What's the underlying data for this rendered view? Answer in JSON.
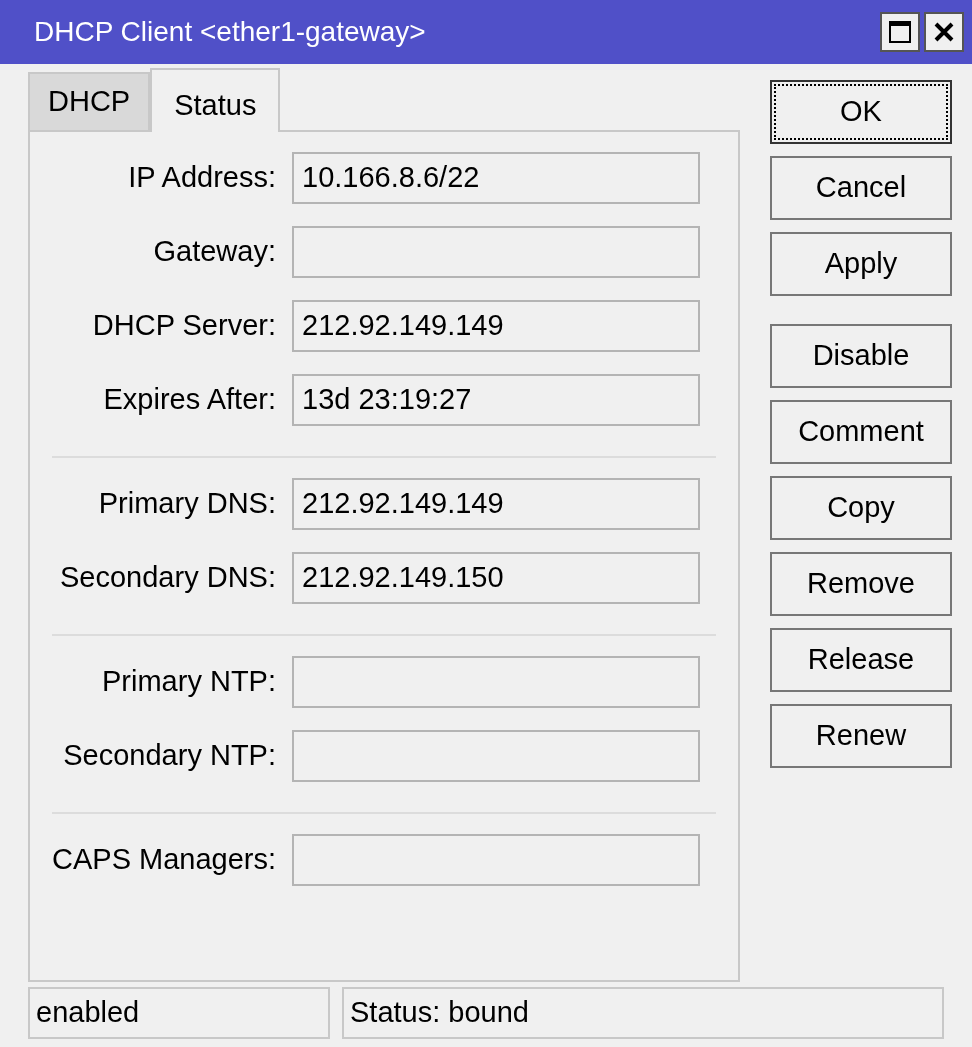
{
  "window": {
    "title": "DHCP Client <ether1-gateway>"
  },
  "tabs": [
    {
      "label": "DHCP",
      "selected": false
    },
    {
      "label": "Status",
      "selected": true
    }
  ],
  "field_groups": [
    [
      {
        "label": "IP Address:",
        "value": "10.166.8.6/22"
      },
      {
        "label": "Gateway:"
      },
      {
        "label": "DHCP Server:",
        "value": "212.92.149.149"
      },
      {
        "label": "Expires After:",
        "value": "13d 23:19:27"
      }
    ],
    [
      {
        "label": "Primary DNS:",
        "value": "212.92.149.149"
      },
      {
        "label": "Secondary DNS:",
        "value": "212.92.149.150"
      }
    ],
    [
      {
        "label": "Primary NTP:"
      },
      {
        "label": "Secondary NTP:"
      }
    ],
    [
      {
        "label": "CAPS Managers:"
      }
    ]
  ],
  "button_groups": [
    [
      {
        "label": "OK",
        "focused": true
      },
      {
        "label": "Cancel",
        "focused": false
      },
      {
        "label": "Apply",
        "focused": false
      }
    ],
    [
      {
        "label": "Disable",
        "focused": false
      },
      {
        "label": "Comment",
        "focused": false
      },
      {
        "label": "Copy",
        "focused": false
      },
      {
        "label": "Remove",
        "focused": false
      },
      {
        "label": "Release",
        "focused": false
      },
      {
        "label": "Renew",
        "focused": false
      }
    ]
  ],
  "status_bar": [
    "enabled",
    "Status: bound"
  ]
}
